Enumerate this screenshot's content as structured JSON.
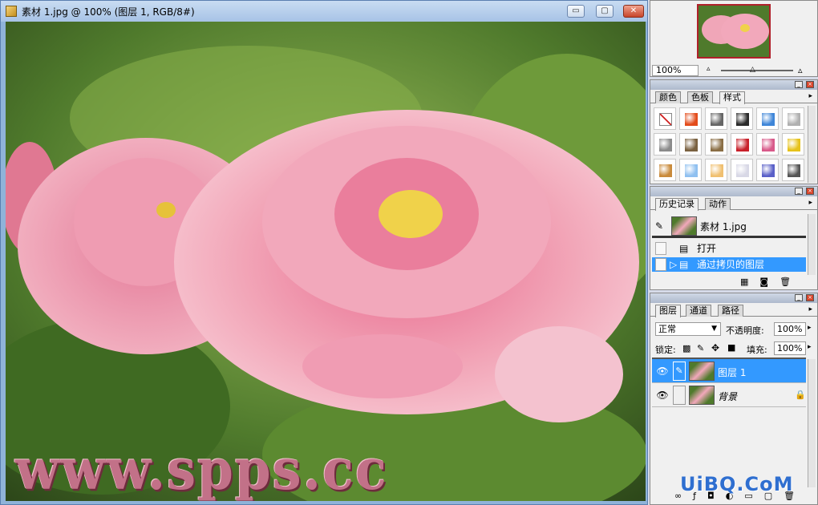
{
  "document": {
    "title": "素材 1.jpg @ 100% (图层 1, RGB/8#)",
    "minimize": "▭",
    "restore": "▢",
    "close": "✕",
    "watermark": "www.spps.cc"
  },
  "navigator": {
    "zoom": "100%"
  },
  "styles_panel": {
    "tabs": [
      "颜色",
      "色板",
      "样式"
    ],
    "swatch_colors": [
      "none",
      "#e34b1a",
      "#666666",
      "#2a2a2a",
      "#3f86d8",
      "#b0b0b0",
      "#8a8a8a",
      "#7a6140",
      "#8a6e45",
      "#c8202a",
      "#d85a8a",
      "#e6c21a",
      "#c98a3a",
      "#8fc0f0",
      "#f0c070",
      "#d8d8e6",
      "#5a60c8",
      "#555555"
    ]
  },
  "history_panel": {
    "tabs": [
      "历史记录",
      "动作"
    ],
    "snapshot": "素材 1.jpg",
    "items": [
      {
        "label": "打开",
        "selected": false
      },
      {
        "label": "通过拷贝的图层",
        "selected": true
      }
    ]
  },
  "layers_panel": {
    "tabs": [
      "图层",
      "通道",
      "路径"
    ],
    "blend_mode": "正常",
    "opacity_label": "不透明度:",
    "opacity_value": "100%",
    "lock_label": "锁定:",
    "fill_label": "填充:",
    "fill_value": "100%",
    "layers": [
      {
        "name": "图层 1",
        "selected": true
      },
      {
        "name": "背景",
        "selected": false
      }
    ]
  },
  "site_logo": "UiBQ.CoM"
}
